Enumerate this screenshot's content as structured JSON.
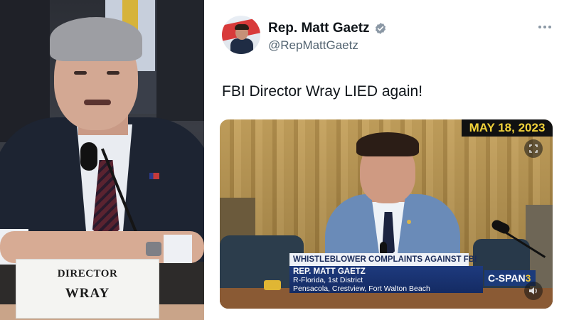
{
  "left_photo": {
    "nameplate": {
      "line1": "DIRECTOR",
      "line2": "WRAY"
    }
  },
  "tweet": {
    "display_name": "Rep. Matt Gaetz",
    "handle": "@RepMattGaetz",
    "text": "FBI Director Wray LIED again!",
    "icons": [
      "verified-badge-icon",
      "more-options-icon"
    ],
    "media": {
      "date_badge": "MAY 18, 2023",
      "lower_third_title": "WHISTLEBLOWER COMPLAINTS AGAINST FBI",
      "lower_third_name": "REP. MATT GAETZ",
      "lower_third_district": "R-Florida, 1st District",
      "lower_third_cities": "Pensacola, Crestview, Fort Walton Beach",
      "network_logo_main": "C-SPAN",
      "network_logo_number": "3",
      "icons": [
        "expand-icon",
        "mute-icon"
      ]
    }
  },
  "colors": {
    "verified": "#8b98a5",
    "date_badge_text": "#f1d23a",
    "lower_third_blue": "#1e3a7e",
    "handle_gray": "#536471"
  }
}
